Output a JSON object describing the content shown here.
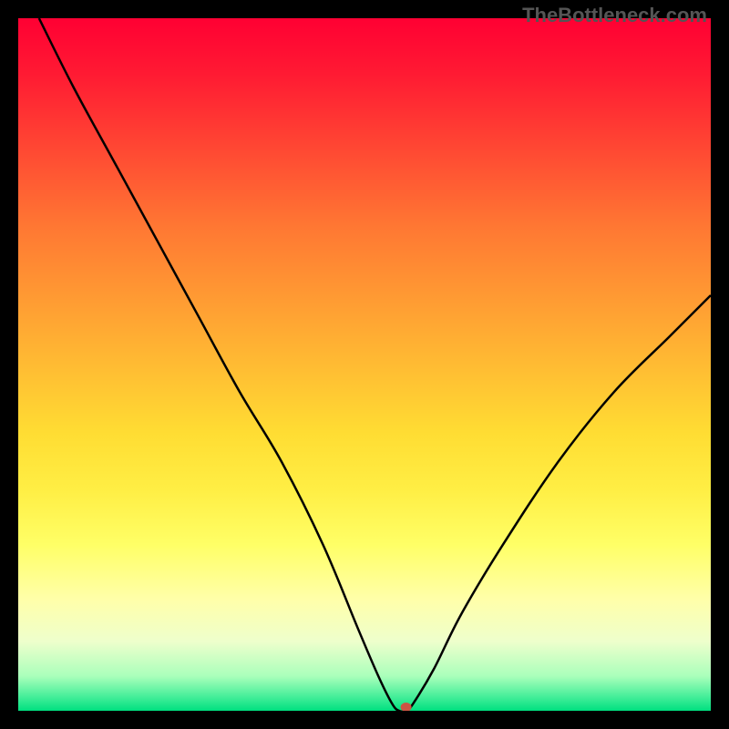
{
  "watermark": "TheBottleneck.com",
  "chart_data": {
    "type": "line",
    "title": "",
    "xlabel": "",
    "ylabel": "",
    "xlim": [
      0,
      100
    ],
    "ylim": [
      0,
      100
    ],
    "grid": false,
    "legend": false,
    "background_gradient": {
      "direction": "vertical",
      "stops": [
        {
          "pos": 0,
          "color": "#ff0033"
        },
        {
          "pos": 50,
          "color": "#ffdd33"
        },
        {
          "pos": 85,
          "color": "#ffffaa"
        },
        {
          "pos": 100,
          "color": "#00e080"
        }
      ]
    },
    "series": [
      {
        "name": "bottleneck-curve",
        "x": [
          3,
          8,
          14,
          20,
          26,
          32,
          38,
          44,
          49,
          52,
          54,
          55,
          56,
          57,
          60,
          64,
          70,
          78,
          86,
          94,
          100
        ],
        "y": [
          100,
          90,
          79,
          68,
          57,
          46,
          36,
          24,
          12,
          5,
          1,
          0,
          0,
          1,
          6,
          14,
          24,
          36,
          46,
          54,
          60
        ]
      }
    ],
    "markers": [
      {
        "name": "optimal-point",
        "x": 56,
        "y": 0,
        "color": "#cc5544"
      }
    ]
  }
}
